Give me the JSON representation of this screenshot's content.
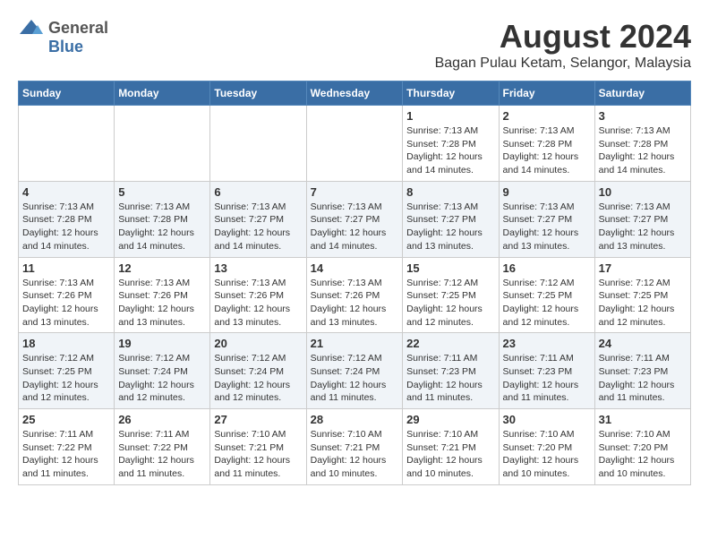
{
  "header": {
    "logo_general": "General",
    "logo_blue": "Blue",
    "month": "August 2024",
    "location": "Bagan Pulau Ketam, Selangor, Malaysia"
  },
  "days_of_week": [
    "Sunday",
    "Monday",
    "Tuesday",
    "Wednesday",
    "Thursday",
    "Friday",
    "Saturday"
  ],
  "weeks": [
    [
      {
        "day": "",
        "info": ""
      },
      {
        "day": "",
        "info": ""
      },
      {
        "day": "",
        "info": ""
      },
      {
        "day": "",
        "info": ""
      },
      {
        "day": "1",
        "info": "Sunrise: 7:13 AM\nSunset: 7:28 PM\nDaylight: 12 hours and 14 minutes."
      },
      {
        "day": "2",
        "info": "Sunrise: 7:13 AM\nSunset: 7:28 PM\nDaylight: 12 hours and 14 minutes."
      },
      {
        "day": "3",
        "info": "Sunrise: 7:13 AM\nSunset: 7:28 PM\nDaylight: 12 hours and 14 minutes."
      }
    ],
    [
      {
        "day": "4",
        "info": "Sunrise: 7:13 AM\nSunset: 7:28 PM\nDaylight: 12 hours and 14 minutes."
      },
      {
        "day": "5",
        "info": "Sunrise: 7:13 AM\nSunset: 7:28 PM\nDaylight: 12 hours and 14 minutes."
      },
      {
        "day": "6",
        "info": "Sunrise: 7:13 AM\nSunset: 7:27 PM\nDaylight: 12 hours and 14 minutes."
      },
      {
        "day": "7",
        "info": "Sunrise: 7:13 AM\nSunset: 7:27 PM\nDaylight: 12 hours and 14 minutes."
      },
      {
        "day": "8",
        "info": "Sunrise: 7:13 AM\nSunset: 7:27 PM\nDaylight: 12 hours and 13 minutes."
      },
      {
        "day": "9",
        "info": "Sunrise: 7:13 AM\nSunset: 7:27 PM\nDaylight: 12 hours and 13 minutes."
      },
      {
        "day": "10",
        "info": "Sunrise: 7:13 AM\nSunset: 7:27 PM\nDaylight: 12 hours and 13 minutes."
      }
    ],
    [
      {
        "day": "11",
        "info": "Sunrise: 7:13 AM\nSunset: 7:26 PM\nDaylight: 12 hours and 13 minutes."
      },
      {
        "day": "12",
        "info": "Sunrise: 7:13 AM\nSunset: 7:26 PM\nDaylight: 12 hours and 13 minutes."
      },
      {
        "day": "13",
        "info": "Sunrise: 7:13 AM\nSunset: 7:26 PM\nDaylight: 12 hours and 13 minutes."
      },
      {
        "day": "14",
        "info": "Sunrise: 7:13 AM\nSunset: 7:26 PM\nDaylight: 12 hours and 13 minutes."
      },
      {
        "day": "15",
        "info": "Sunrise: 7:12 AM\nSunset: 7:25 PM\nDaylight: 12 hours and 12 minutes."
      },
      {
        "day": "16",
        "info": "Sunrise: 7:12 AM\nSunset: 7:25 PM\nDaylight: 12 hours and 12 minutes."
      },
      {
        "day": "17",
        "info": "Sunrise: 7:12 AM\nSunset: 7:25 PM\nDaylight: 12 hours and 12 minutes."
      }
    ],
    [
      {
        "day": "18",
        "info": "Sunrise: 7:12 AM\nSunset: 7:25 PM\nDaylight: 12 hours and 12 minutes."
      },
      {
        "day": "19",
        "info": "Sunrise: 7:12 AM\nSunset: 7:24 PM\nDaylight: 12 hours and 12 minutes."
      },
      {
        "day": "20",
        "info": "Sunrise: 7:12 AM\nSunset: 7:24 PM\nDaylight: 12 hours and 12 minutes."
      },
      {
        "day": "21",
        "info": "Sunrise: 7:12 AM\nSunset: 7:24 PM\nDaylight: 12 hours and 11 minutes."
      },
      {
        "day": "22",
        "info": "Sunrise: 7:11 AM\nSunset: 7:23 PM\nDaylight: 12 hours and 11 minutes."
      },
      {
        "day": "23",
        "info": "Sunrise: 7:11 AM\nSunset: 7:23 PM\nDaylight: 12 hours and 11 minutes."
      },
      {
        "day": "24",
        "info": "Sunrise: 7:11 AM\nSunset: 7:23 PM\nDaylight: 12 hours and 11 minutes."
      }
    ],
    [
      {
        "day": "25",
        "info": "Sunrise: 7:11 AM\nSunset: 7:22 PM\nDaylight: 12 hours and 11 minutes."
      },
      {
        "day": "26",
        "info": "Sunrise: 7:11 AM\nSunset: 7:22 PM\nDaylight: 12 hours and 11 minutes."
      },
      {
        "day": "27",
        "info": "Sunrise: 7:10 AM\nSunset: 7:21 PM\nDaylight: 12 hours and 11 minutes."
      },
      {
        "day": "28",
        "info": "Sunrise: 7:10 AM\nSunset: 7:21 PM\nDaylight: 12 hours and 10 minutes."
      },
      {
        "day": "29",
        "info": "Sunrise: 7:10 AM\nSunset: 7:21 PM\nDaylight: 12 hours and 10 minutes."
      },
      {
        "day": "30",
        "info": "Sunrise: 7:10 AM\nSunset: 7:20 PM\nDaylight: 12 hours and 10 minutes."
      },
      {
        "day": "31",
        "info": "Sunrise: 7:10 AM\nSunset: 7:20 PM\nDaylight: 12 hours and 10 minutes."
      }
    ]
  ]
}
